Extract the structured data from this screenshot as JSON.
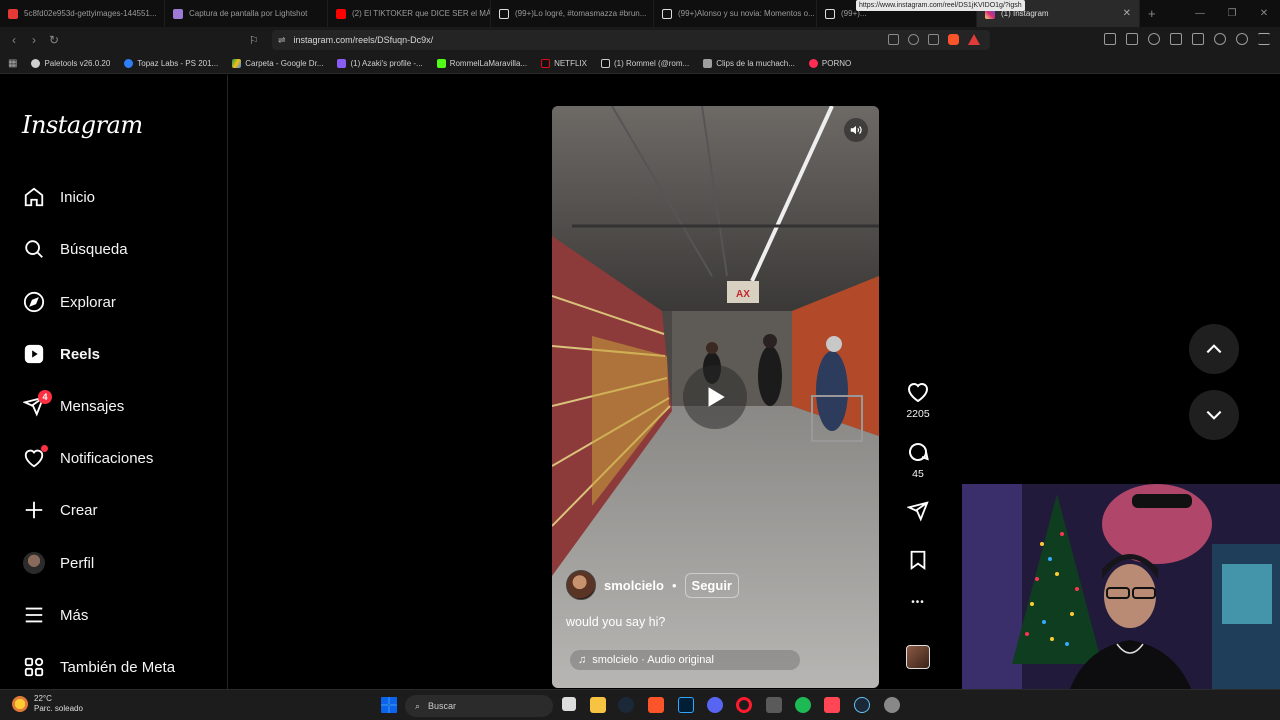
{
  "browser": {
    "tabs": [
      {
        "title": "5c8fd02e953d-gettyimages-144551...",
        "color": "#e53935"
      },
      {
        "title": "Captura de pantalla por Lightshot",
        "color": "#9c7ad6"
      },
      {
        "title": "(2) El TIKTOKER que DICE SER el MÁ...",
        "color": "#ff0000"
      },
      {
        "title": "(99+)Lo logré, #tomasmazza #brun...",
        "color": "#ffffff"
      },
      {
        "title": "(99+)Alonso y su novia: Momentos o...",
        "color": "#ffffff"
      },
      {
        "title": "(99+)...",
        "color": "#ffffff"
      },
      {
        "title": "(1) Instagram",
        "color": "#d6249f"
      }
    ],
    "hover_url": "https://www.instagram.com/reel/DS1jKVIDO1g/?igsh",
    "url": "instagram.com/reels/DSfuqn-Dc9x/",
    "bookmarks": [
      {
        "label": "Paletools v26.0.20",
        "color": "#cfcfcf"
      },
      {
        "label": "Topaz Labs - PS 201...",
        "color": "#2d7ef7"
      },
      {
        "label": "Carpeta - Google Dr...",
        "color": "#f4c20d"
      },
      {
        "label": "(1) Azaki's profile -...",
        "color": "#8a5cf6"
      },
      {
        "label": "RommelLaMaravilla...",
        "color": "#53fc18"
      },
      {
        "label": "NETFLIX",
        "color": "#000000"
      },
      {
        "label": "(1) Rommel (@rom...",
        "color": "#000000"
      },
      {
        "label": "Clips de la muchach...",
        "color": "#9e9e9e"
      },
      {
        "label": "PORNO",
        "color": "#ff2d55"
      }
    ]
  },
  "sidebar": {
    "logo": "Instagram",
    "items": [
      {
        "label": "Inicio",
        "icon": "home-icon"
      },
      {
        "label": "Búsqueda",
        "icon": "search-icon"
      },
      {
        "label": "Explorar",
        "icon": "compass-icon"
      },
      {
        "label": "Reels",
        "icon": "reels-icon"
      },
      {
        "label": "Mensajes",
        "icon": "messages-icon",
        "badge": "4"
      },
      {
        "label": "Notificaciones",
        "icon": "heart-icon"
      },
      {
        "label": "Crear",
        "icon": "plus-icon"
      },
      {
        "label": "Perfil",
        "icon": "profile-avatar"
      },
      {
        "label": "Más",
        "icon": "menu-icon"
      },
      {
        "label": "También de Meta",
        "icon": "meta-apps-icon"
      }
    ]
  },
  "reel": {
    "username": "smolcielo",
    "separator": "•",
    "follow_label": "Seguir",
    "caption": "would you say hi?",
    "audio": "smolcielo · Audio original",
    "likes": "2205",
    "comments": "45",
    "more": "•••"
  },
  "taskbar": {
    "temperature": "22°C",
    "weather": "Parc. soleado",
    "search_placeholder": "Buscar"
  }
}
